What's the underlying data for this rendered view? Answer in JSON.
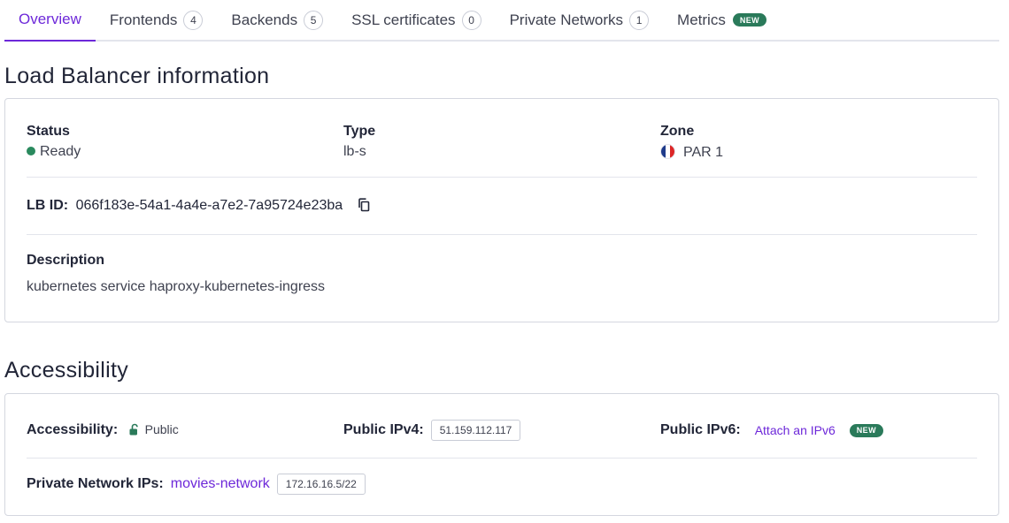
{
  "tabs": [
    {
      "label": "Overview",
      "active": true
    },
    {
      "label": "Frontends",
      "count": "4"
    },
    {
      "label": "Backends",
      "count": "5"
    },
    {
      "label": "SSL certificates",
      "count": "0"
    },
    {
      "label": "Private Networks",
      "count": "1"
    },
    {
      "label": "Metrics",
      "badge": "NEW"
    }
  ],
  "lb_info": {
    "title": "Load Balancer information",
    "status_label": "Status",
    "status_value": "Ready",
    "status_color": "#2a8a5e",
    "type_label": "Type",
    "type_value": "lb-s",
    "zone_label": "Zone",
    "zone_value": "PAR 1",
    "zone_flag": "france-flag-icon",
    "id_label": "LB ID:",
    "id_value": "066f183e-54a1-4a4e-a7e2-7a95724e23ba",
    "copy_icon": "copy-icon",
    "description_label": "Description",
    "description_value": "kubernetes service haproxy-kubernetes-ingress"
  },
  "accessibility": {
    "title": "Accessibility",
    "accessibility_label": "Accessibility:",
    "accessibility_value": "Public",
    "lock_icon": "unlock-icon",
    "ipv4_label": "Public IPv4:",
    "ipv4_value": "51.159.112.117",
    "ipv6_label": "Public IPv6:",
    "ipv6_link": "Attach an IPv6",
    "ipv6_badge": "NEW",
    "pn_label": "Private Network IPs:",
    "pn_link": "movies-network",
    "pn_ip": "172.16.16.5/22"
  },
  "colors": {
    "accent": "#6d28d9",
    "badge_green": "#2a7a5a",
    "border": "#d4d7df"
  }
}
